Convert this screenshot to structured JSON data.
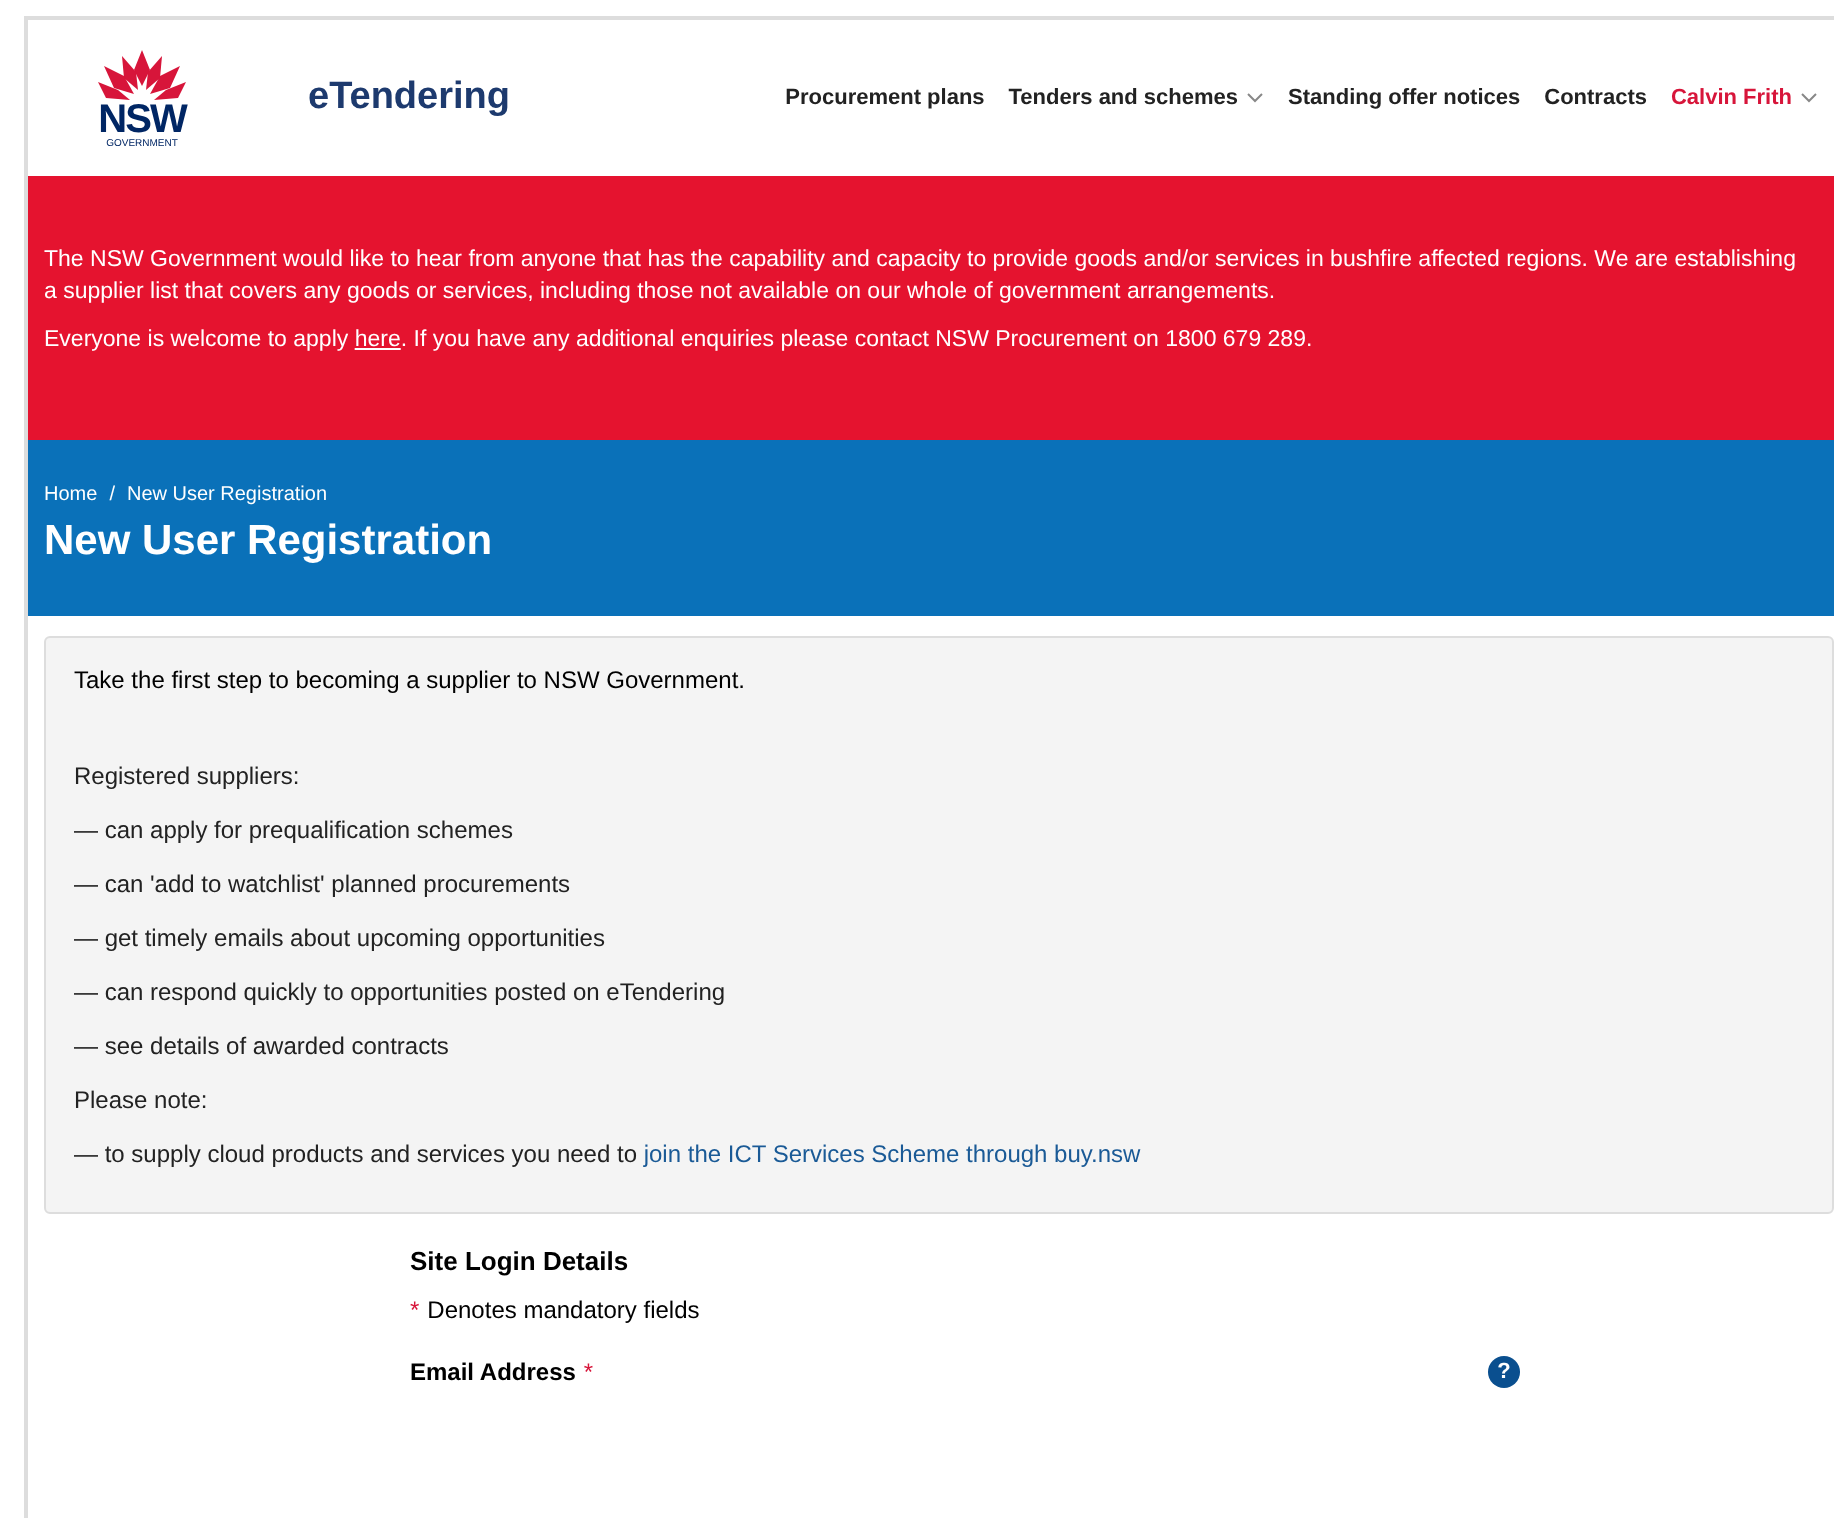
{
  "header": {
    "logo_text": "NSW",
    "logo_subtext": "GOVERNMENT",
    "site_name": "eTendering",
    "nav": [
      {
        "label": "Procurement plans",
        "kind": "link",
        "has_dropdown": false
      },
      {
        "label": "Tenders and schemes",
        "kind": "link",
        "has_dropdown": true
      },
      {
        "label": "Standing offer notices",
        "kind": "link",
        "has_dropdown": false
      },
      {
        "label": "Contracts",
        "kind": "link",
        "has_dropdown": false
      },
      {
        "label": "Calvin Frith",
        "kind": "user",
        "has_dropdown": true
      }
    ]
  },
  "alert": {
    "message": "The NSW Government would like to hear from anyone that has the capability and capacity to provide goods and/or services in bushfire affected regions. We are establishing a supplier list that covers any goods or services, including those not available on our whole of government arrangements.",
    "apply_before": "Everyone is welcome to apply ",
    "apply_link": "here",
    "apply_after": ". If you have any additional enquiries please contact NSW Procurement on 1800 679 289."
  },
  "breadcrumb": [
    {
      "label": "Home",
      "separator": "/"
    },
    {
      "label": "New User Registration"
    }
  ],
  "page_title": "New User Registration",
  "intro": {
    "lead": "Take the first step to becoming a supplier to NSW Government.",
    "benefits_heading": "Registered suppliers:",
    "benefits": [
      "— can apply for prequalification schemes",
      "— can 'add to watchlist' planned procurements",
      "— get timely emails about upcoming opportunities",
      "— can respond quickly to opportunities posted on eTendering",
      "— see details of awarded contracts"
    ],
    "note_heading": "Please note:",
    "note_before": "— to supply cloud products and services you need to ",
    "note_link": "join the ICT Services Scheme through buy.nsw"
  },
  "form": {
    "section_title": "Site Login Details",
    "required_mark": "*",
    "mandatory_note": "Denotes mandatory fields",
    "fields": [
      {
        "label": "Email Address",
        "required": true,
        "help": "?"
      }
    ]
  }
}
